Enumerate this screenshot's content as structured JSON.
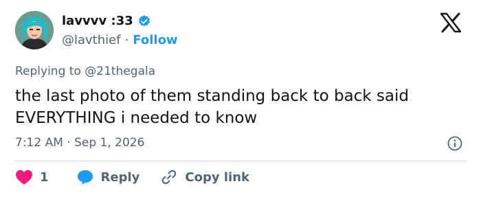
{
  "author": {
    "display_name": "lavvvv :33",
    "handle": "@lavthief",
    "separator": "·",
    "follow_label": "Follow",
    "verified_color": "#1d9bf0"
  },
  "reply_context": {
    "prefix": "Replying to",
    "mention": "@21thegala"
  },
  "tweet": {
    "text": "the last photo of them standing back to back said EVERYTHING i needed to know"
  },
  "meta": {
    "time": "7:12 AM",
    "separator": "·",
    "date": "Sep 1, 2026"
  },
  "actions": {
    "like_count": "1",
    "reply_label": "Reply",
    "copy_link_label": "Copy link"
  },
  "icons": {
    "logo": "x-logo-icon",
    "info": "info-icon",
    "like": "heart-icon",
    "reply": "speech-bubble-icon",
    "copy": "link-icon"
  },
  "colors": {
    "heart": "#f91880",
    "reply_bubble": "#1d9bf0",
    "follow": "#1d9bf0",
    "muted": "#536471"
  }
}
